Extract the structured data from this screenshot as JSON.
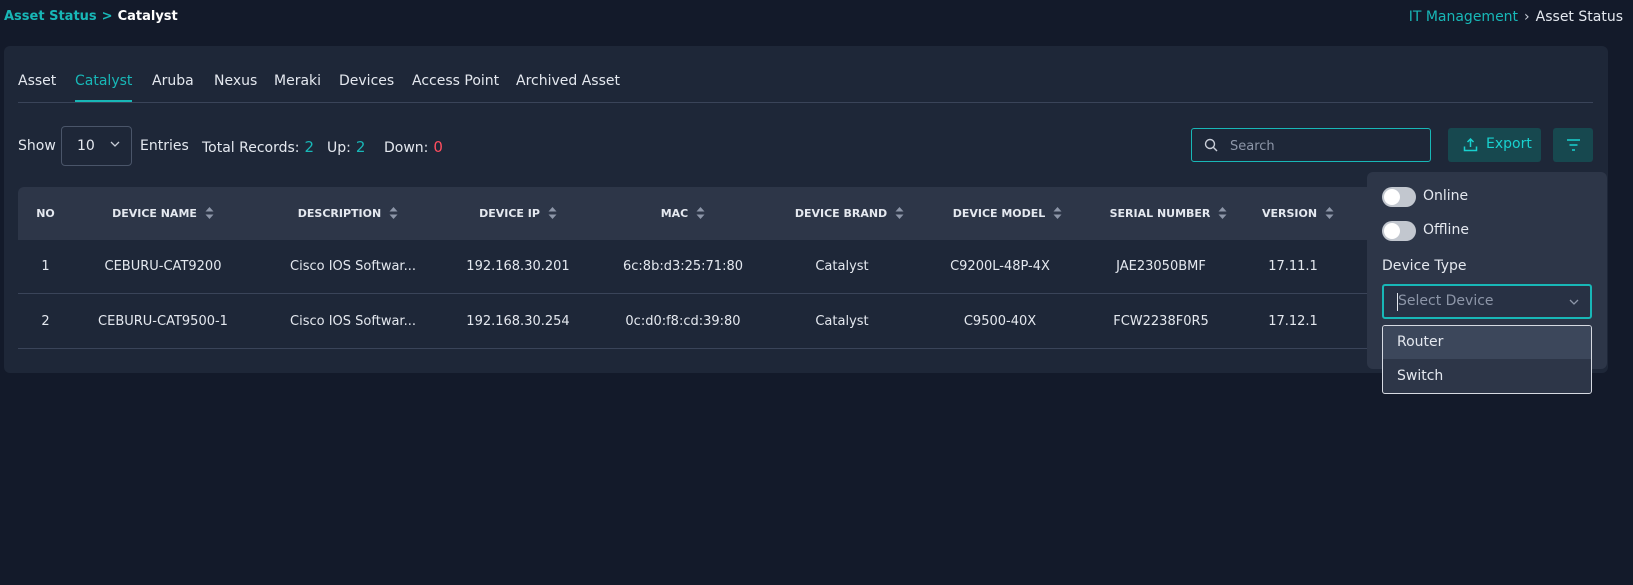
{
  "breadcrumb_left": {
    "parent": "Asset Status",
    "separator": ">",
    "current": "Catalyst"
  },
  "breadcrumb_right": {
    "parent": "IT Management",
    "separator": "›",
    "current": "Asset Status"
  },
  "tabs": [
    {
      "label": "Asset",
      "active": false
    },
    {
      "label": "Catalyst",
      "active": true
    },
    {
      "label": "Aruba",
      "active": false
    },
    {
      "label": "Nexus",
      "active": false
    },
    {
      "label": "Meraki",
      "active": false
    },
    {
      "label": "Devices",
      "active": false
    },
    {
      "label": "Access Point",
      "active": false
    },
    {
      "label": "Archived Asset",
      "active": false
    }
  ],
  "controls": {
    "show_label": "Show",
    "entries_value": "10",
    "entries_label": "Entries",
    "total_label": "Total Records:",
    "total_value": "2",
    "up_label": "Up:",
    "up_value": "2",
    "down_label": "Down:",
    "down_value": "0"
  },
  "search": {
    "placeholder": "Search",
    "value": ""
  },
  "export_label": "Export",
  "table": {
    "columns": [
      "NO",
      "DEVICE NAME",
      "DESCRIPTION",
      "DEVICE IP",
      "MAC",
      "DEVICE BRAND",
      "DEVICE MODEL",
      "SERIAL NUMBER",
      "VERSION"
    ],
    "rows": [
      [
        "1",
        "CEBURU-CAT9200",
        "Cisco IOS Softwar...",
        "192.168.30.201",
        "6c:8b:d3:25:71:80",
        "Catalyst",
        "C9200L-48P-4X",
        "JAE23050BMF",
        "17.11.1"
      ],
      [
        "2",
        "CEBURU-CAT9500-1",
        "Cisco IOS Softwar...",
        "192.168.30.254",
        "0c:d0:f8:cd:39:80",
        "Catalyst",
        "C9500-40X",
        "FCW2238F0R5",
        "17.12.1"
      ]
    ]
  },
  "filter_panel": {
    "online_label": "Online",
    "offline_label": "Offline",
    "device_type_label": "Device Type",
    "device_select_placeholder": "Select Device",
    "options": [
      "Router",
      "Switch"
    ]
  },
  "colors": {
    "accent": "#18b7b7",
    "down": "#ff4d5e",
    "background": "#131a2a",
    "card": "#1e2738",
    "header": "#2d3648"
  }
}
